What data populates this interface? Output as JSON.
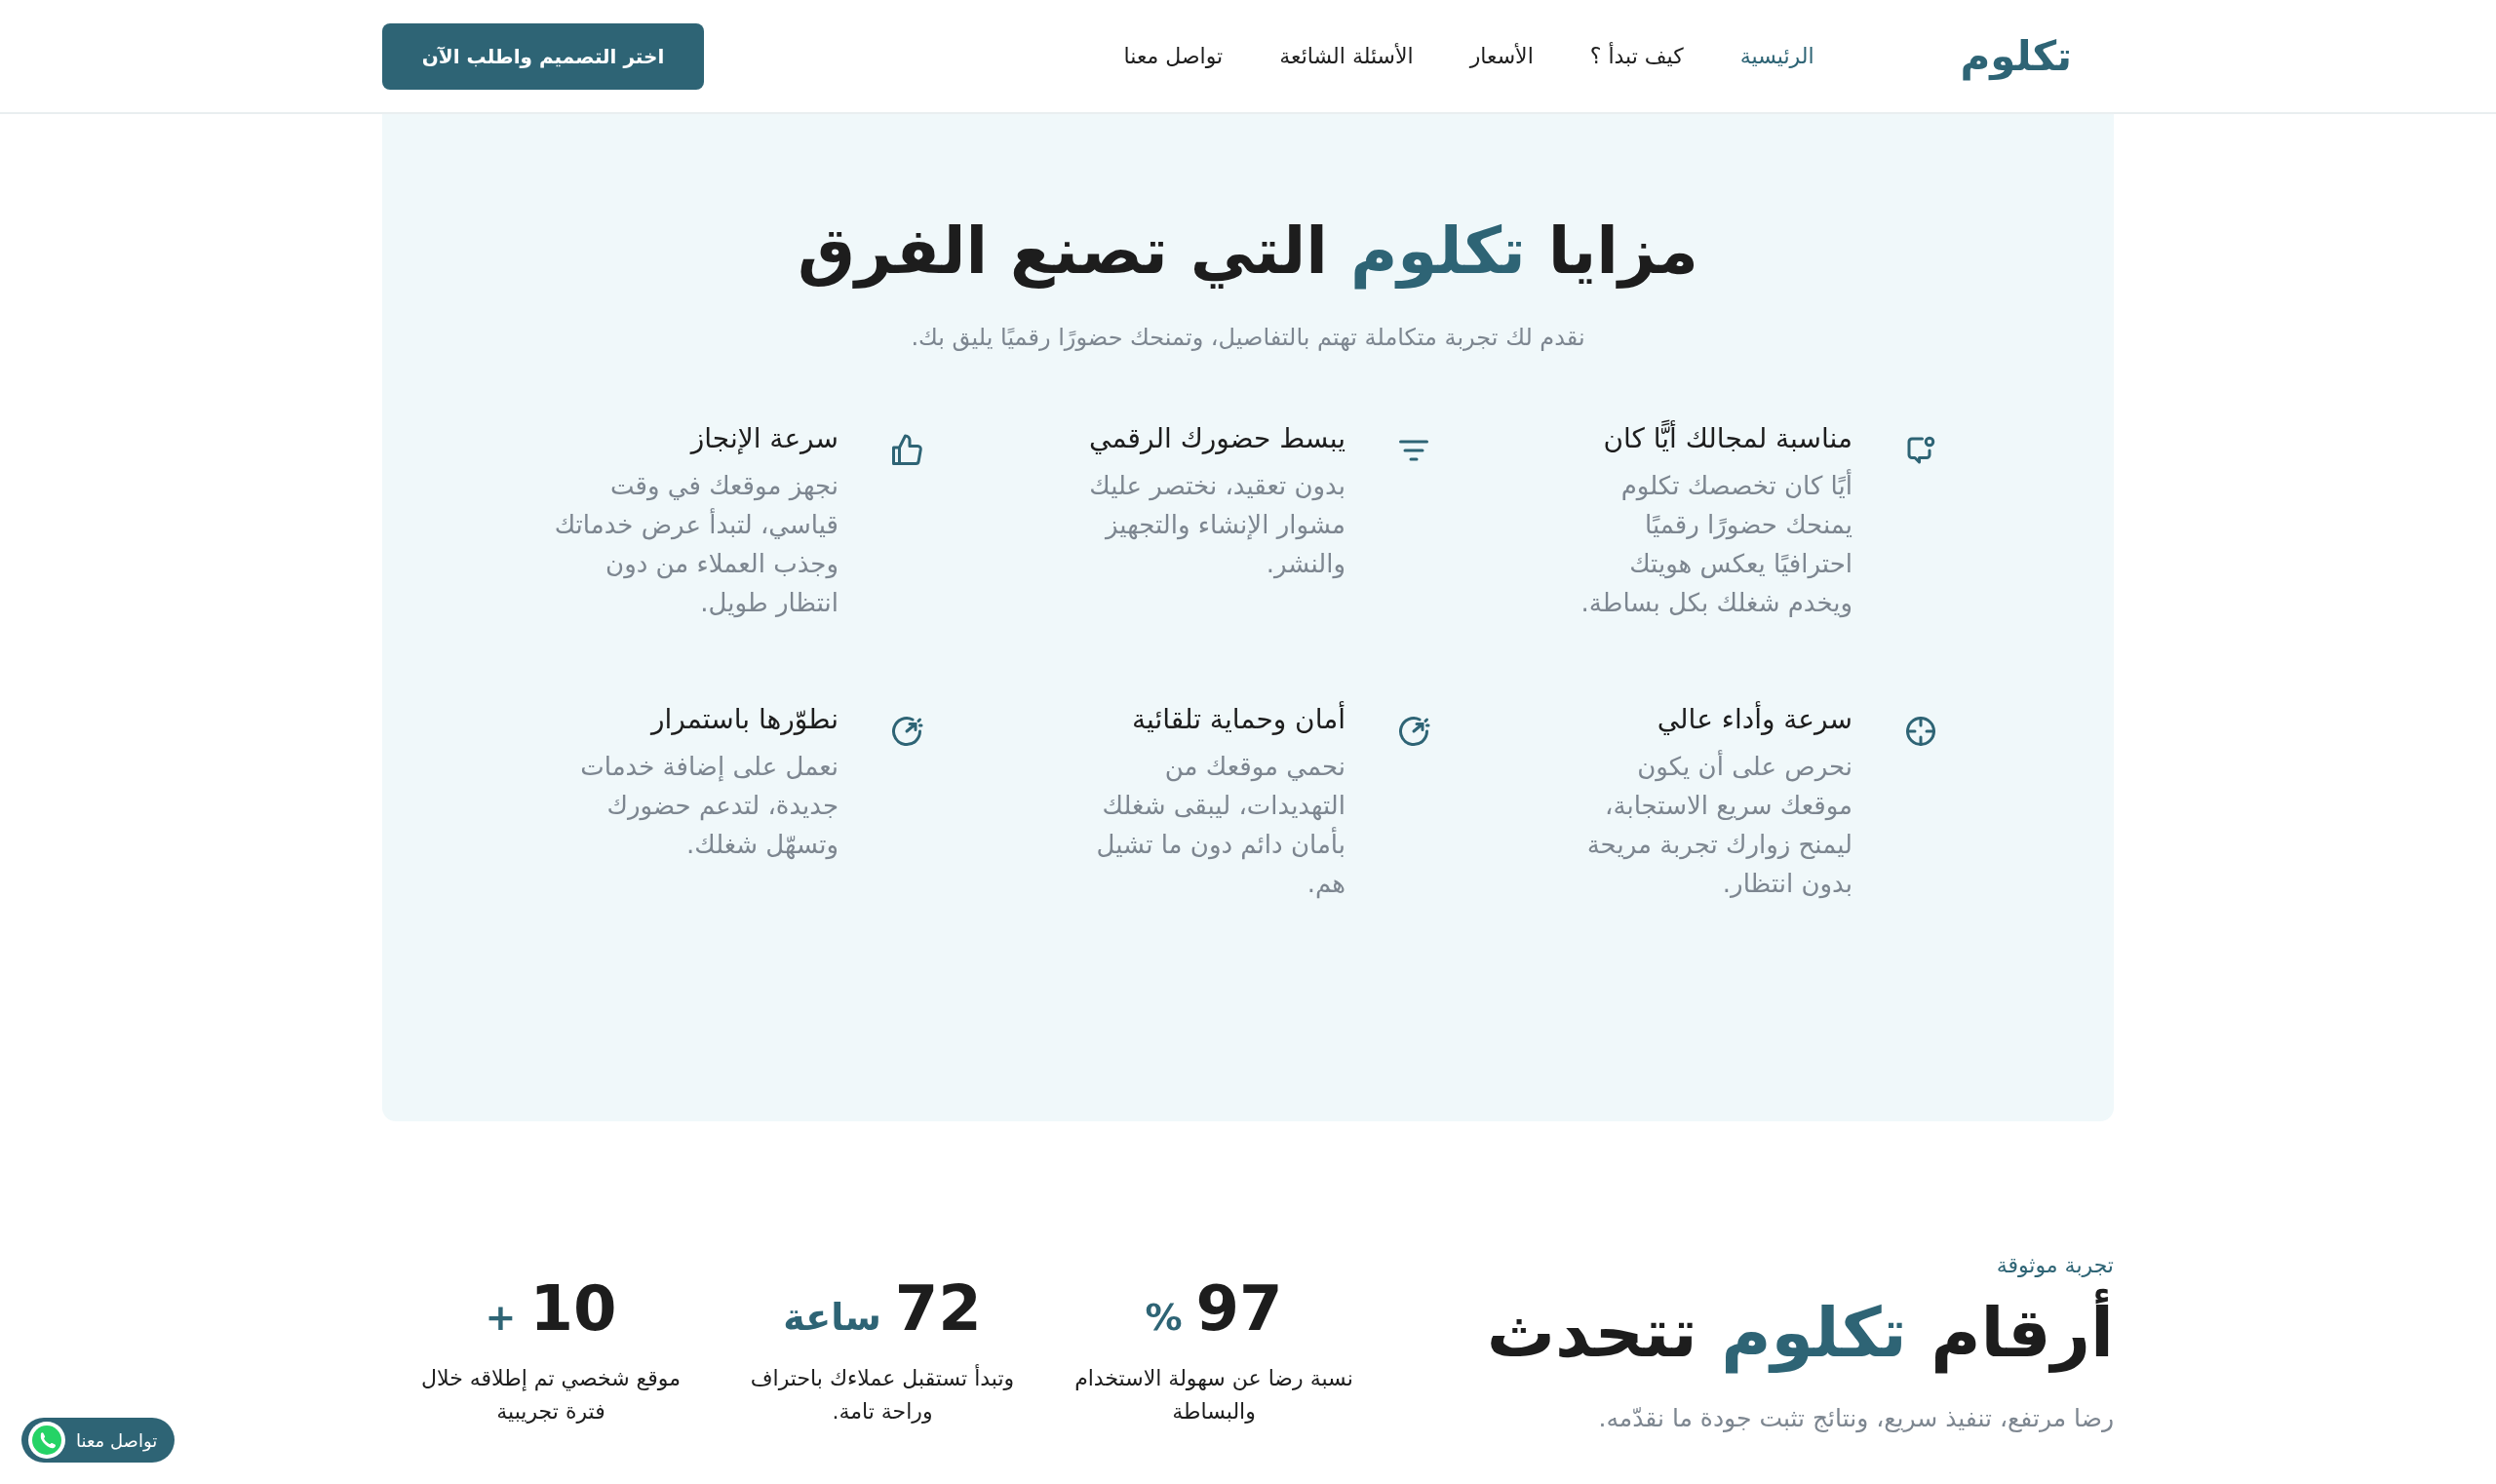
{
  "nav": {
    "logo": "تكلوم",
    "links": [
      {
        "label": "الرئيسية",
        "selected": true
      },
      {
        "label": "كيف تبدأ ؟",
        "selected": false
      },
      {
        "label": "الأسعار",
        "selected": false
      },
      {
        "label": "الأسئلة الشائعة",
        "selected": false
      },
      {
        "label": "تواصل معنا",
        "selected": false
      }
    ],
    "cta": "اختر التصميم واطلب الآن"
  },
  "features": {
    "title_parts": [
      {
        "text": "مزايا",
        "accent": false
      },
      {
        "text": "تكلوم",
        "accent": true
      },
      {
        "text": "التي تصنع الفرق",
        "accent": false
      }
    ],
    "subtitle": "نقدم لك تجربة متكاملة تهتم بالتفاصيل، وتمنحك حضورًا رقميًا يليق بك.",
    "items": [
      {
        "kind": "chat",
        "title": "مناسبة لمجالك أيًّا كان",
        "description": "أيًا كان تخصصك تكلوم يمنحك حضورًا رقميًا احترافيًا يعكس هويتك ويخدم شغلك بكل بساطة."
      },
      {
        "kind": "filter",
        "title": "يبسط حضورك الرقمي",
        "description": "بدون تعقيد، نختصر عليك مشوار الإنشاء والتجهيز والنشر."
      },
      {
        "kind": "thumb",
        "title": "سرعة الإنجاز",
        "description": "نجهز موقعك في وقت قياسي، لتبدأ عرض خدماتك وجذب العملاء من دون انتظار طويل."
      },
      {
        "kind": "target",
        "title": "سرعة وأداء عالي",
        "description": "نحرص على أن يكون موقعك سريع الاستجابة، ليمنح زوارك تجربة مريحة بدون انتظار."
      },
      {
        "kind": "gauge",
        "title": "أمان وحماية تلقائية",
        "description": "نحمي موقعك من التهديدات، ليبقى شغلك بأمان دائم دون ما تشيل هم."
      },
      {
        "kind": "gauge",
        "title": "نطوّرها باستمرار",
        "description": "نعمل على إضافة خدمات جديدة، لتدعم حضورك وتسهّل شغلك."
      }
    ]
  },
  "stats": {
    "eyebrow": "تجربة موثوقة",
    "title_parts": [
      {
        "text": "أرقام",
        "accent": false
      },
      {
        "text": "تكلوم",
        "accent": true
      },
      {
        "text": "تتحدث",
        "accent": false
      }
    ],
    "subtitle": "رضا مرتفع، تنفيذ سريع، ونتائج تثبت جودة ما نقدّمه.",
    "items": [
      {
        "value": "97",
        "unit": "%",
        "caption": "نسبة رضا عن سهولة الاستخدام والبساطة"
      },
      {
        "value": "72",
        "unit": "ساعة",
        "caption": "وتبدأ تستقبل عملاءك باحتراف وراحة تامة."
      },
      {
        "value": "10",
        "unit": "+",
        "caption": "موقع شخصي تم إطلاقه خلال فترة تجريبية"
      }
    ]
  },
  "whatsapp": {
    "label": "تواصل معنا"
  }
}
